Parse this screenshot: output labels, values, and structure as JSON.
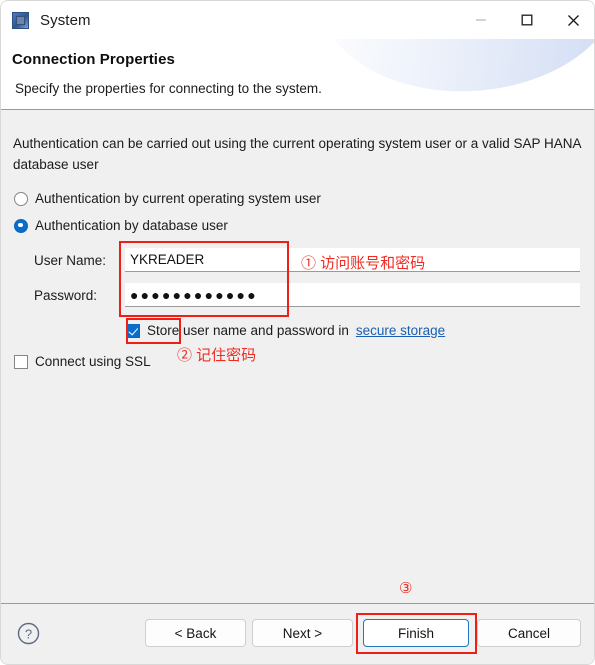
{
  "window": {
    "title": "System",
    "icon": "system-window-icon",
    "controls": {
      "minimize": "minimize-icon",
      "maximize": "maximize-icon",
      "close": "close-icon"
    }
  },
  "header": {
    "title": "Connection Properties",
    "subtitle": "Specify the properties for connecting to the system."
  },
  "content": {
    "intro": "Authentication can be carried out using the current operating system user or a valid SAP HANA database user",
    "radios": [
      {
        "label": "Authentication by current operating system user",
        "selected": false
      },
      {
        "label": "Authentication by database user",
        "selected": true
      }
    ],
    "fields": {
      "user_name": {
        "label": "User Name:",
        "value": "YKREADER",
        "placeholder": ""
      },
      "password": {
        "label": "Password:",
        "value": "●●●●●●●●●●●●",
        "placeholder": ""
      }
    },
    "store_checkbox": {
      "checked": true,
      "text_before": "Store user name and password in",
      "link_text": "secure storage"
    },
    "ssl_checkbox": {
      "checked": false,
      "label": "Connect using SSL"
    }
  },
  "annotations": {
    "one": "①  访问账号和密码",
    "two": "②  记住密码",
    "three": "③",
    "color": "#ef2b22"
  },
  "footer": {
    "help": "help-icon",
    "buttons": [
      {
        "label": "< Back",
        "name": "back-button",
        "primary": false
      },
      {
        "label": "Next >",
        "name": "next-button",
        "primary": false
      },
      {
        "label": "Finish",
        "name": "finish-button",
        "primary": true
      },
      {
        "label": "Cancel",
        "name": "cancel-button",
        "primary": false
      }
    ]
  }
}
